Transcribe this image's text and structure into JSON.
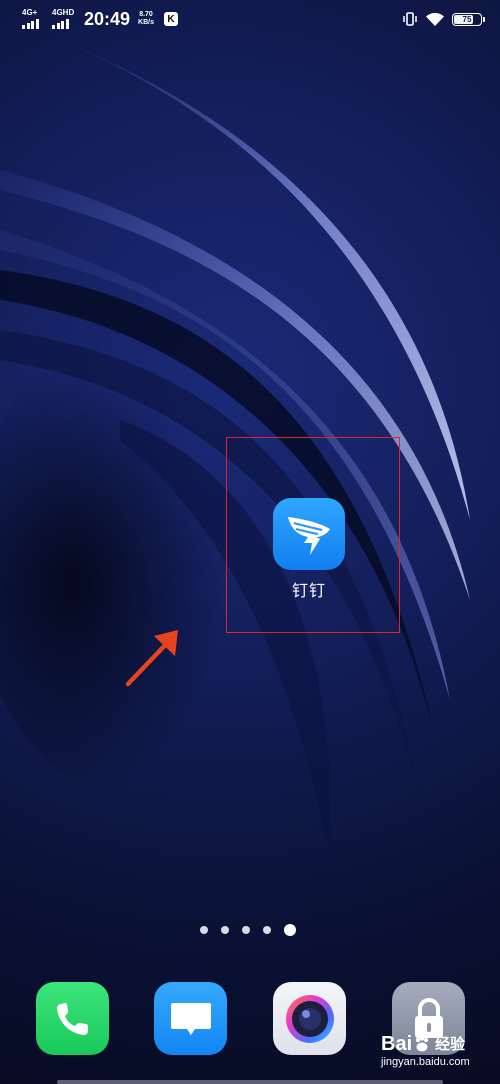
{
  "status_bar": {
    "sim1_label": "4G+",
    "sim2_label": "4GHD",
    "time": "20:49",
    "speed_value": "8.70",
    "speed_unit": "KB/s",
    "badge_letter": "K",
    "battery_level": "75",
    "icons": [
      "signal-icon",
      "vibrate-icon",
      "wifi-icon",
      "battery-icon"
    ]
  },
  "home": {
    "app": {
      "label": "钉钉",
      "icon": "dingtalk-icon",
      "highlighted": true
    },
    "annotation": {
      "icon": "arrow-icon",
      "color": "#e8431f"
    },
    "highlight_color": "#d9262c",
    "page_indicator": {
      "count": 5,
      "active_index": 4
    }
  },
  "dock": {
    "apps": [
      {
        "name": "phone",
        "icon": "phone-icon",
        "color": "#22d064"
      },
      {
        "name": "messages",
        "icon": "message-icon",
        "color": "#1a8ff5"
      },
      {
        "name": "camera",
        "icon": "camera-icon",
        "color": "#eceef3"
      },
      {
        "name": "lock",
        "icon": "lock-icon",
        "color": "#8c94a6"
      }
    ]
  },
  "watermark": {
    "brand_pre": "Bai",
    "brand_post": "经验",
    "url": "jingyan.baidu.com"
  }
}
